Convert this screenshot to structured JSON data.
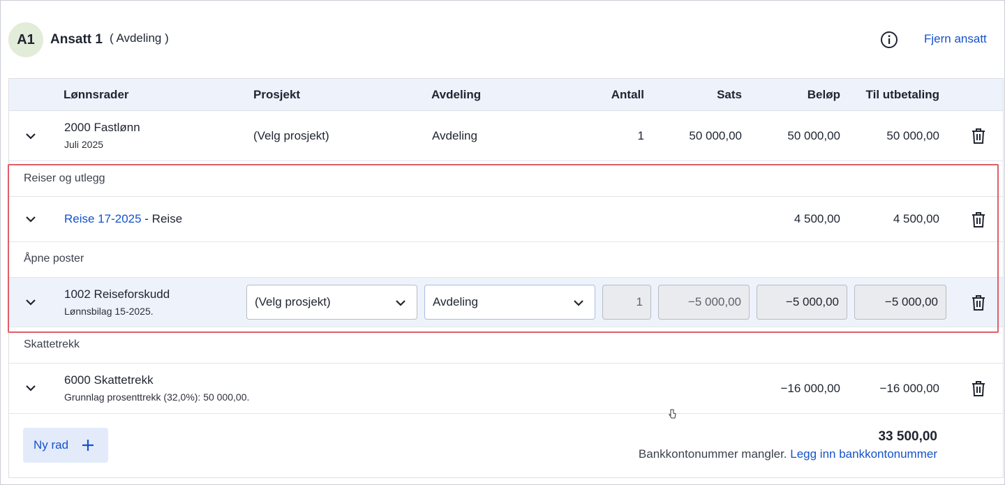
{
  "employee": {
    "initials": "A1",
    "name": "Ansatt 1",
    "department": "( Avdeling )",
    "remove_label": "Fjern ansatt"
  },
  "columns": {
    "lines": "Lønnsrader",
    "project": "Prosjekt",
    "department": "Avdeling",
    "quantity": "Antall",
    "rate": "Sats",
    "amount": "Beløp",
    "payout": "Til utbetaling"
  },
  "row_salary": {
    "title": "2000 Fastlønn",
    "subtitle": "Juli 2025",
    "project": "(Velg prosjekt)",
    "department": "Avdeling",
    "quantity": "1",
    "rate": "50 000,00",
    "amount": "50 000,00",
    "payout": "50 000,00"
  },
  "section_travel": "Reiser og utlegg",
  "row_travel": {
    "link": "Reise 17-2025",
    "suffix": " - Reise",
    "amount": "4 500,00",
    "payout": "4 500,00"
  },
  "section_open": "Åpne poster",
  "row_advance": {
    "title": "1002 Reiseforskudd",
    "subtitle": "Lønnsbilag 15-2025.",
    "project_select": "(Velg prosjekt)",
    "department_select": "Avdeling",
    "quantity": "1",
    "rate": "−5 000,00",
    "amount": "−5 000,00",
    "payout": "−5 000,00"
  },
  "section_tax": "Skattetrekk",
  "row_tax": {
    "title": "6000 Skattetrekk",
    "subtitle": "Grunnlag prosenttrekk (32,0%): 50 000,00.",
    "amount": "−16 000,00",
    "payout": "−16 000,00"
  },
  "footer": {
    "new_row_label": "Ny rad",
    "total": "33 500,00",
    "bank_missing": "Bankkontonummer mangler. ",
    "bank_link": "Legg inn bankkontonummer"
  },
  "colors": {
    "accent": "#1452cc",
    "highlight": "#e05d66",
    "header_bg": "#eef2fb"
  },
  "icons": [
    "info-icon",
    "chevron-down-icon",
    "trash-icon",
    "plus-icon"
  ]
}
